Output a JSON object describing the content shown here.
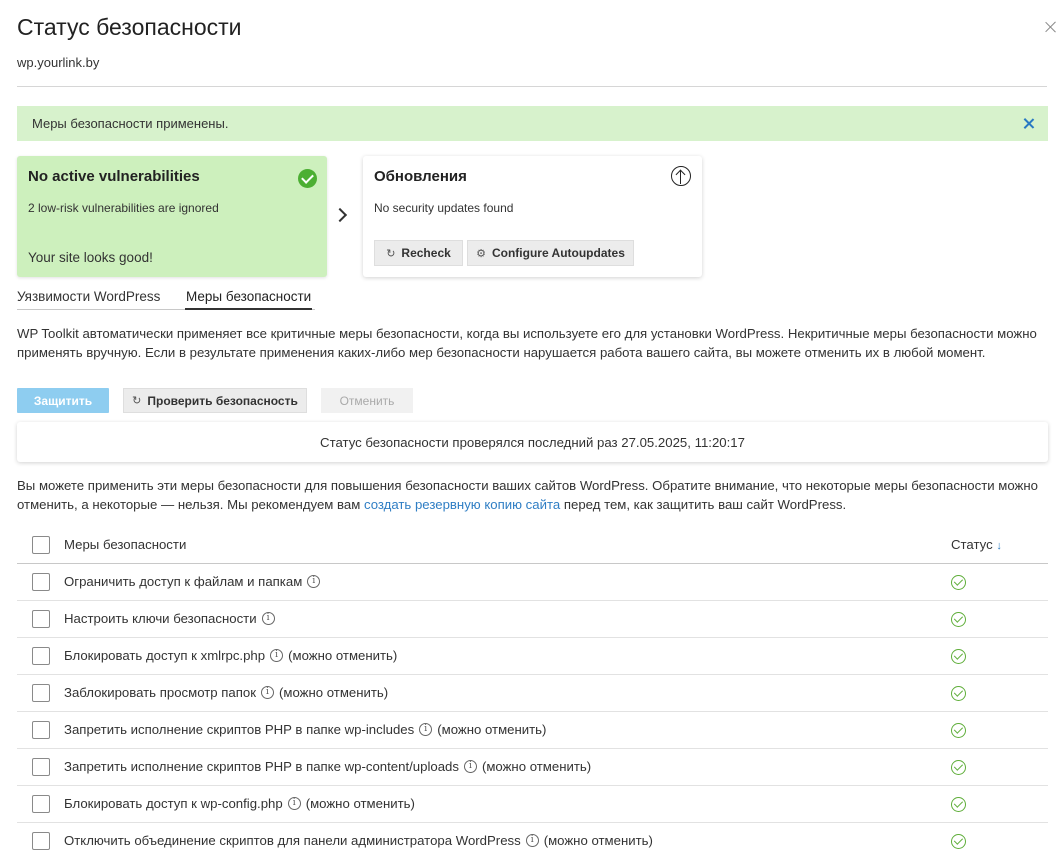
{
  "header": {
    "title": "Статус безопасности",
    "subtitle": "wp.yourlink.by"
  },
  "alert": {
    "text": "Меры безопасности применены."
  },
  "vulnerabilities_card": {
    "title": "No active vulnerabilities",
    "subtitle": "2 low-risk vulnerabilities are ignored",
    "footer": "Your site looks good!"
  },
  "updates_card": {
    "title": "Обновления",
    "subtitle": "No security updates found",
    "recheck_label": "Recheck",
    "autoupdates_label": "Configure Autoupdates"
  },
  "tabs": [
    {
      "label": "Уязвимости WordPress",
      "active": false
    },
    {
      "label": "Меры безопасности",
      "active": true
    }
  ],
  "description": "WP Toolkit автоматически применяет все критичные меры безопасности, когда вы используете его для установки WordPress. Некритичные меры безопасности можно применять вручную. Если в результате применения каких-либо мер безопасности нарушается работа вашего сайта, вы можете отменить их в любой момент.",
  "actions": {
    "protect_label": "Защитить",
    "check_label": "Проверить безопасность",
    "undo_label": "Отменить"
  },
  "last_check": "Статус безопасности проверялся последний раз 27.05.2025, 11:20:17",
  "description2": {
    "before": "Вы можете применить эти меры безопасности для повышения безопасности ваших сайтов WordPress. Обратите внимание, что некоторые меры безопасности можно отменить, а некоторые — нельзя. Мы рекомендуем вам ",
    "link": "создать резервную копию сайта",
    "after": " перед тем, как защитить ваш сайт WordPress."
  },
  "table": {
    "header_name": "Меры безопасности",
    "header_status": "Статус",
    "sort_arrow": "↓",
    "rows": [
      {
        "name": "Ограничить доступ к файлам и папкам",
        "suffix": ""
      },
      {
        "name": "Настроить ключи безопасности",
        "suffix": ""
      },
      {
        "name": "Блокировать доступ к xmlrpc.php",
        "suffix": "(можно отменить)"
      },
      {
        "name": "Заблокировать просмотр папок",
        "suffix": "(можно отменить)"
      },
      {
        "name": "Запретить исполнение скриптов PHP в папке wp-includes",
        "suffix": "(можно отменить)"
      },
      {
        "name": "Запретить исполнение скриптов PHP в папке wp-content/uploads",
        "suffix": "(можно отменить)"
      },
      {
        "name": "Блокировать доступ к wp-config.php",
        "suffix": "(можно отменить)"
      },
      {
        "name": "Отключить объединение скриптов для панели администратора WordPress",
        "suffix": "(можно отменить)"
      }
    ]
  },
  "icons": {
    "info_glyph": "i",
    "refresh_glyph": "↻",
    "settings_glyph": "⚙"
  },
  "colors": {
    "success_bg": "#d7f2cc",
    "card_green": "#cdf0bd",
    "accent_blue": "#2f7ec4",
    "ok_green": "#5fae3a"
  }
}
